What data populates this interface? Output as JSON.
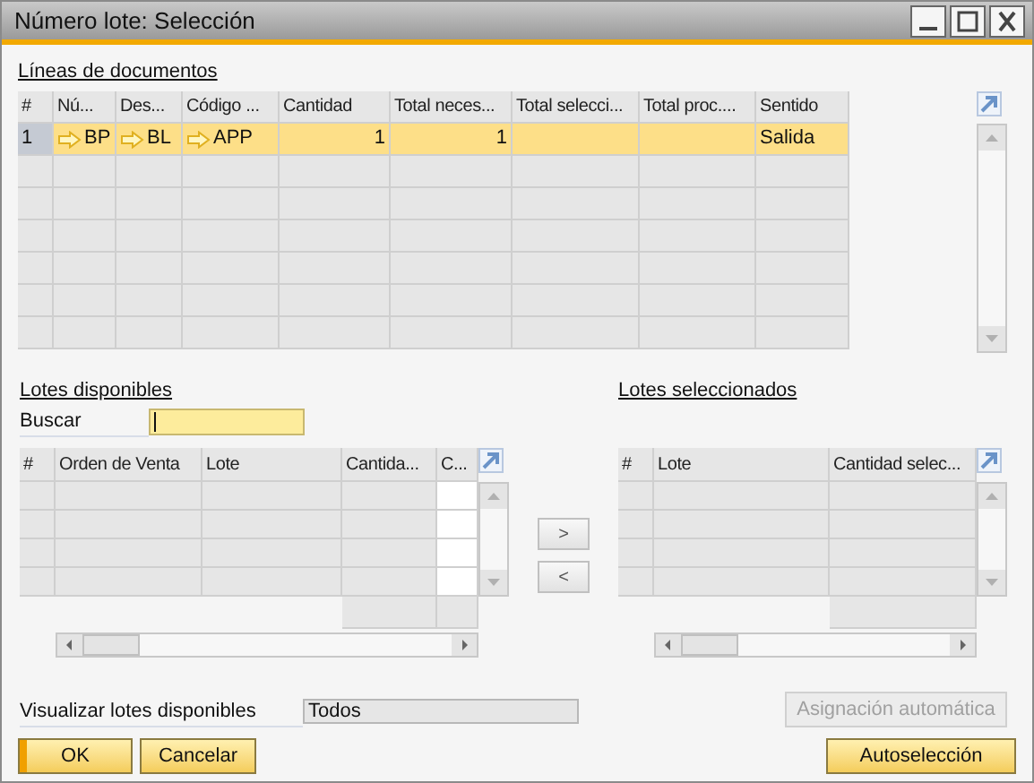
{
  "window": {
    "title": "Número lote: Selección"
  },
  "documents": {
    "title": "Líneas de documentos",
    "columns": [
      "#",
      "Nú...",
      "Des...",
      "Código ...",
      "Cantidad",
      "Total neces...",
      "Total selecci...",
      "Total proc....",
      "Sentido"
    ],
    "rows": [
      {
        "selected": true,
        "cells": [
          {
            "text": "1",
            "kind": "plain"
          },
          {
            "text": "BP",
            "kind": "link"
          },
          {
            "text": "BL",
            "kind": "link"
          },
          {
            "text": "APP",
            "kind": "link"
          },
          {
            "text": "1",
            "kind": "number"
          },
          {
            "text": "1",
            "kind": "number"
          },
          {
            "text": "",
            "kind": "plain"
          },
          {
            "text": "",
            "kind": "plain"
          },
          {
            "text": "Salida",
            "kind": "plain"
          }
        ]
      }
    ]
  },
  "available": {
    "title": "Lotes disponibles",
    "search_label": "Buscar",
    "search_focused": true,
    "columns": [
      "#",
      "Orden de Venta",
      "Lote",
      "Cantida...",
      "C..."
    ]
  },
  "selected_batches": {
    "title": "Lotes seleccionados",
    "columns": [
      "#",
      "Lote",
      "Cantidad selec..."
    ]
  },
  "move_buttons": [
    ">",
    "<"
  ],
  "filter": {
    "label": "Visualizar lotes disponibles",
    "value": "Todos"
  },
  "buttons": [
    {
      "label": "OK",
      "default": true,
      "disabled": false
    },
    {
      "label": "Cancelar",
      "default": false,
      "disabled": false
    }
  ],
  "right_buttons": [
    {
      "label": "Asignación automática",
      "default": false,
      "disabled": true
    },
    {
      "label": "Autoselección",
      "default": false,
      "disabled": false
    }
  ]
}
